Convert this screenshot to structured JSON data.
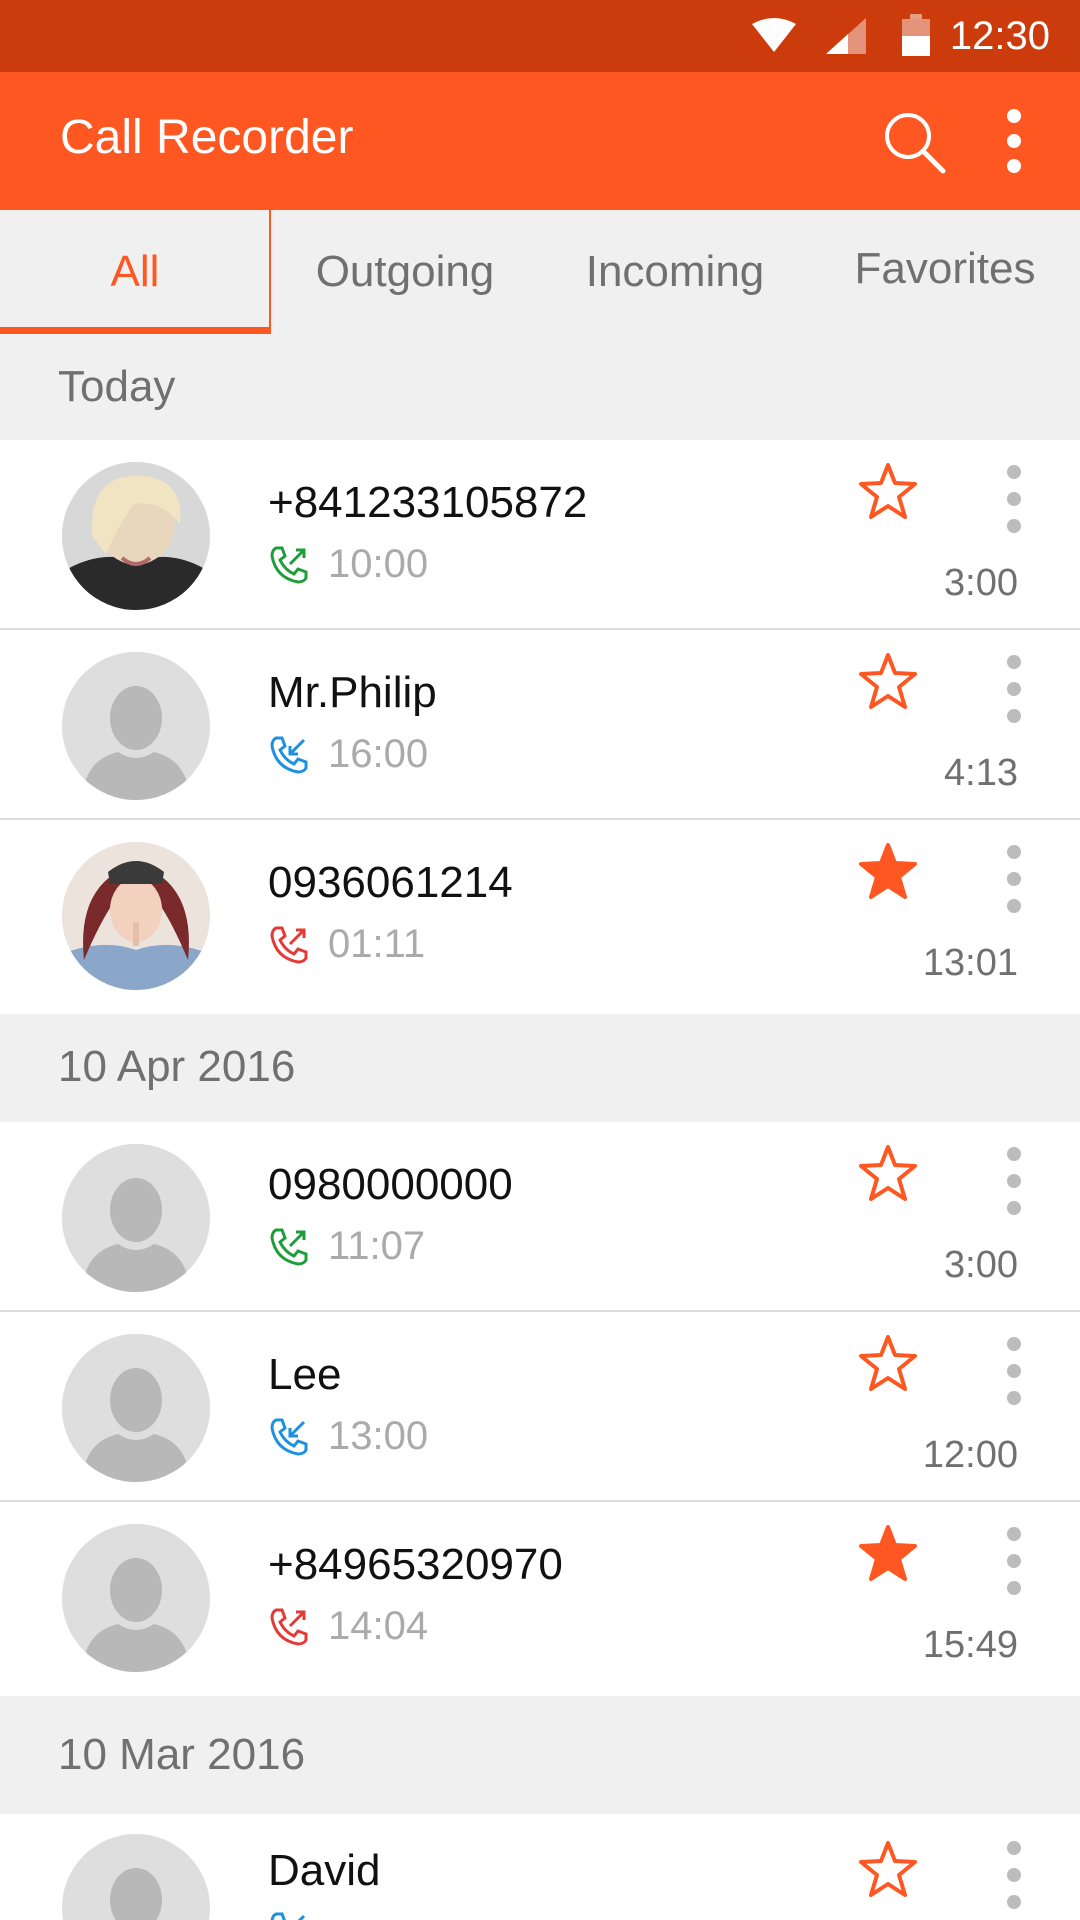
{
  "status_bar": {
    "time": "12:30"
  },
  "app_bar": {
    "title": "Call Recorder"
  },
  "tabs": [
    {
      "label": "All",
      "active": true
    },
    {
      "label": "Outgoing",
      "active": false
    },
    {
      "label": "Incoming",
      "active": false
    },
    {
      "label": "Favorites",
      "active": false
    }
  ],
  "sections": [
    {
      "label": "Today"
    },
    {
      "label": "10 Apr 2016"
    },
    {
      "label": "10 Mar 2016"
    }
  ],
  "recordings": [
    {
      "name": "+841233105872",
      "call_time": "10:00",
      "duration": "3:00",
      "direction": "outgoing",
      "favorite": false,
      "avatar": "photo-blonde"
    },
    {
      "name": "Mr.Philip",
      "call_time": "16:00",
      "duration": "4:13",
      "direction": "incoming",
      "favorite": false,
      "avatar": "placeholder"
    },
    {
      "name": "0936061214",
      "call_time": "01:11",
      "duration": "13:01",
      "direction": "missed",
      "favorite": true,
      "avatar": "photo-redhair"
    },
    {
      "name": "0980000000",
      "call_time": "11:07",
      "duration": "3:00",
      "direction": "outgoing",
      "favorite": false,
      "avatar": "placeholder"
    },
    {
      "name": "Lee",
      "call_time": "13:00",
      "duration": "12:00",
      "direction": "incoming",
      "favorite": false,
      "avatar": "placeholder"
    },
    {
      "name": "+84965320970",
      "call_time": "14:04",
      "duration": "15:49",
      "direction": "missed",
      "favorite": true,
      "avatar": "placeholder"
    },
    {
      "name": "David",
      "call_time": "",
      "duration": "",
      "direction": "incoming",
      "favorite": false,
      "avatar": "placeholder"
    }
  ],
  "colors": {
    "accent": "#ff5722",
    "status_bar": "#cc3b0b",
    "outgoing": "#1e9e3a",
    "incoming": "#1e90e0",
    "missed": "#e53935"
  }
}
